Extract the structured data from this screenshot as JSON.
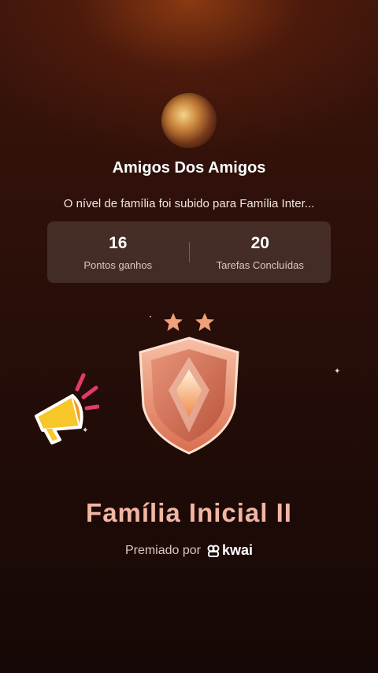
{
  "group": {
    "name": "Amigos Dos Amigos",
    "message": "O nível de família foi subido para Família Inter..."
  },
  "stats": [
    {
      "value": "16",
      "label": "Pontos ganhos"
    },
    {
      "value": "20",
      "label": "Tarefas Concluídas"
    }
  ],
  "badge": {
    "stars": 2,
    "level_name": "Família Inicial II"
  },
  "awarded": {
    "prefix": "Premiado por",
    "brand": "kwai"
  },
  "colors": {
    "accent_text": "#f2b6a2",
    "badge_main": "#e08b6c",
    "star": "#f0a07a"
  },
  "icons": [
    "avatar-image",
    "star-icon",
    "shield-badge-icon",
    "megaphone-icon",
    "kwai-logo-icon",
    "sparkle-icon"
  ]
}
